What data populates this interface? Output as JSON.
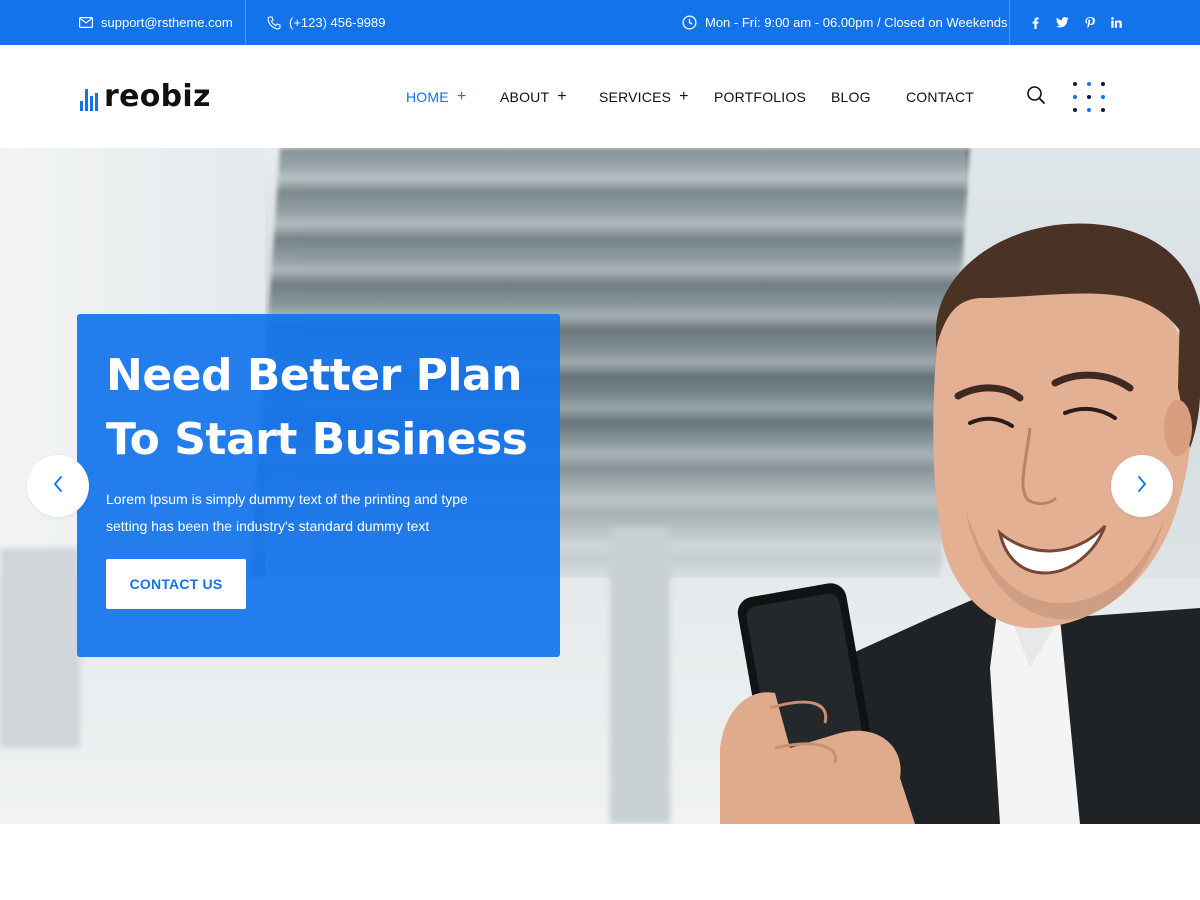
{
  "topbar": {
    "email": "support@rstheme.com",
    "phone": "(+123) 456-9989",
    "hours": "Mon - Fri: 9:00 am - 06.00pm / Closed on Weekends",
    "social": [
      "facebook-icon",
      "twitter-icon",
      "pinterest-icon",
      "linkedin-icon"
    ],
    "bg_color": "#1273eb"
  },
  "header": {
    "logo_text": "reobiz",
    "nav": [
      {
        "label": "HOME",
        "has_submenu": true,
        "active": true
      },
      {
        "label": "ABOUT",
        "has_submenu": true,
        "active": false
      },
      {
        "label": "SERVICES",
        "has_submenu": true,
        "active": false
      },
      {
        "label": "PORTFOLIOS",
        "has_submenu": false,
        "active": false
      },
      {
        "label": "BLOG",
        "has_submenu": false,
        "active": false
      },
      {
        "label": "CONTACT",
        "has_submenu": false,
        "active": false
      }
    ],
    "icons": [
      "search-icon",
      "grid-menu-icon"
    ]
  },
  "hero": {
    "title_line1": "Need Better Plan",
    "title_line2": "To Start Business",
    "text": "Lorem Ipsum is simply dummy text of the printing and type setting has been the industry's standard dummy text",
    "button_label": "CONTACT US",
    "prev_icon": "chevron-left-icon",
    "next_icon": "chevron-right-icon",
    "accent_color": "#1273eb"
  }
}
